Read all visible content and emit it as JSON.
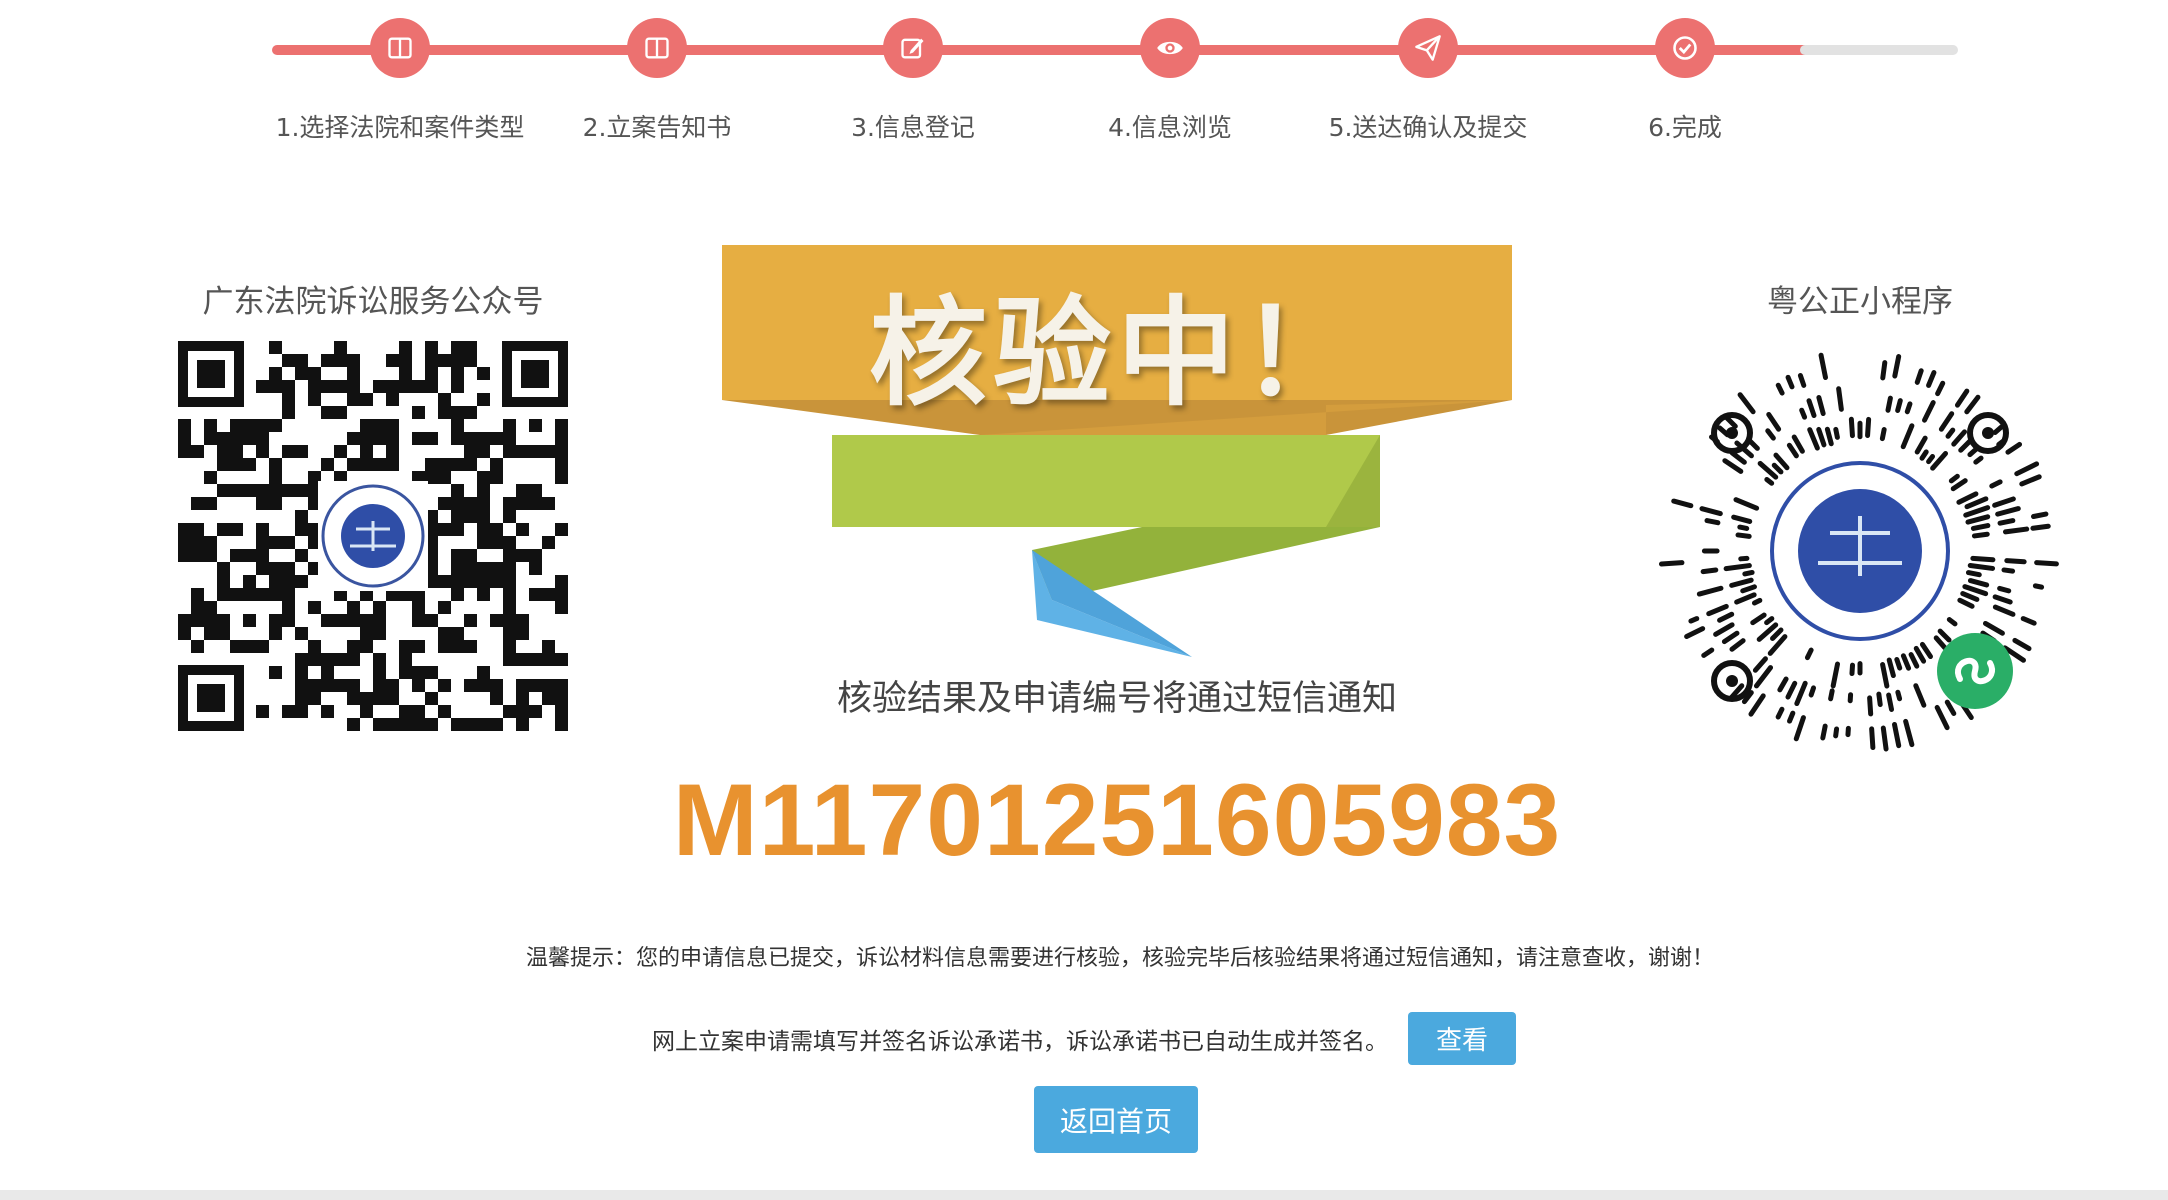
{
  "steps": {
    "items": [
      {
        "label": "1.选择法院和案件类型",
        "icon": "layout-columns-icon"
      },
      {
        "label": "2.立案告知书",
        "icon": "layout-columns-icon"
      },
      {
        "label": "3.信息登记",
        "icon": "edit-icon"
      },
      {
        "label": "4.信息浏览",
        "icon": "eye-icon"
      },
      {
        "label": "5.送达确认及提交",
        "icon": "send-icon"
      },
      {
        "label": "6.完成",
        "icon": "check-circle-icon"
      }
    ],
    "completed_count": 6,
    "progress": 0.93
  },
  "qr_left": {
    "title": "广东法院诉讼服务公众号",
    "icon": "qr-code-icon"
  },
  "qr_right": {
    "title": "粤公正小程序",
    "icon": "mini-program-code-icon"
  },
  "banner": {
    "text": "核验中！",
    "colors": {
      "top": "#e6ae42",
      "middle": "#b0c94a",
      "bottom": "#5fb2e6"
    }
  },
  "result": {
    "notice": "核验结果及申请编号将通过短信通知",
    "application_number": "M11701251605983"
  },
  "tip": {
    "text": "温馨提示：您的申请信息已提交，诉讼材料信息需要进行核验，核验完毕后核验结果将通过短信通知，请注意查收，谢谢！"
  },
  "pledge": {
    "text": "网上立案申请需填写并签名诉讼承诺书，诉讼承诺书已自动生成并签名。",
    "view_button": "查看"
  },
  "home_button": "返回首页",
  "colors": {
    "accent": "#ec7170",
    "number": "#e8922f",
    "button": "#4ba9de"
  }
}
